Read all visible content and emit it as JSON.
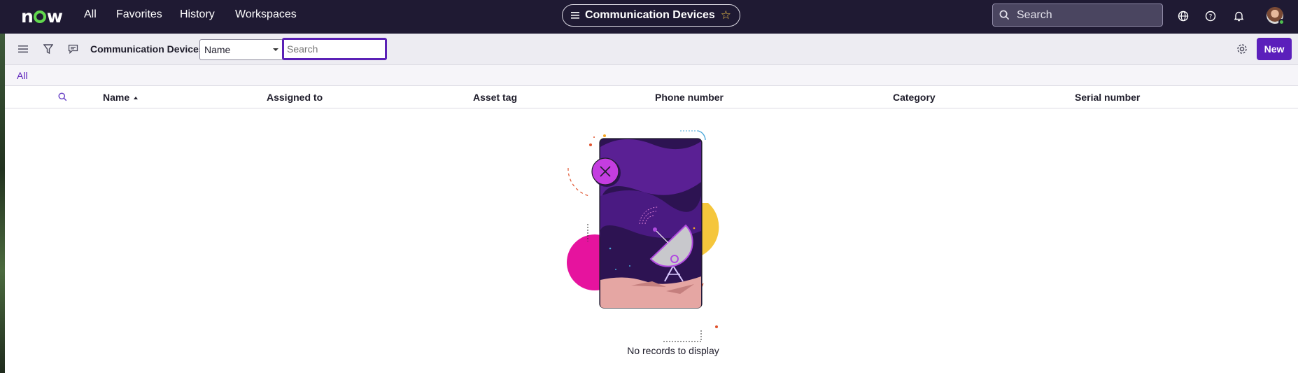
{
  "topnav": {
    "brand": "now",
    "links": [
      "All",
      "Favorites",
      "History",
      "Workspaces"
    ],
    "context_title": "Communication Devices",
    "search_placeholder": "Search"
  },
  "toolbar": {
    "list_title": "Communication Devices",
    "field_select_value": "Name",
    "search_placeholder": "Search",
    "new_label": "New"
  },
  "breadcrumb": {
    "label": "All"
  },
  "table": {
    "columns": [
      "Name",
      "Assigned to",
      "Asset tag",
      "Phone number",
      "Category",
      "Serial number"
    ],
    "sorted_column": "Name",
    "sort_direction": "ascending",
    "rows": []
  },
  "empty_state": {
    "message": "No records to display"
  },
  "colors": {
    "accent": "#5b1fbb",
    "nav_bg": "#1f1a33",
    "brand_green": "#62d84e"
  }
}
